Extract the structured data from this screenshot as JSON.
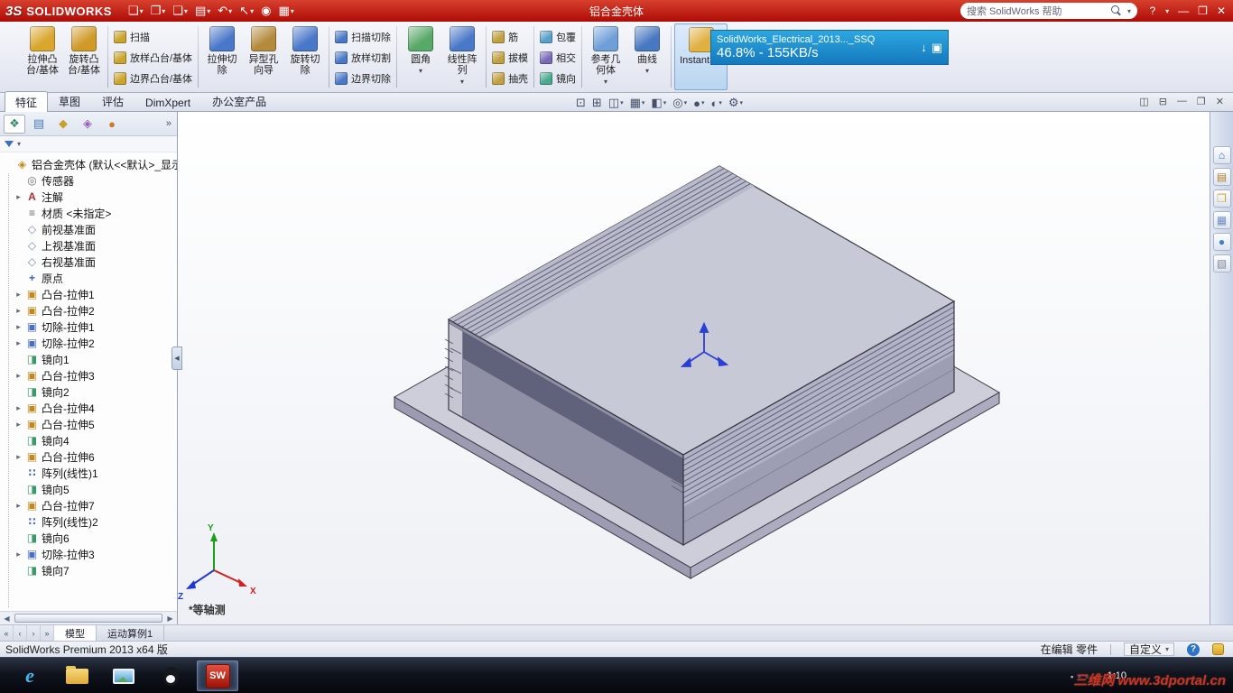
{
  "colors": {
    "title-red-1": "#d8402e",
    "title-red-2": "#ad0b05",
    "toast-blue-1": "#2da7e0",
    "toast-blue-2": "#1479bd",
    "model-top": "#c8c9d6",
    "model-top-band": "#b9bbcb",
    "model-front": "#8f90a6",
    "model-front-dark": "#60617a",
    "model-right": "#9d9eb3",
    "model-right-band": "#b2b3c6",
    "model-flange-top": "#cdceda",
    "model-flange-front": "#9b9cb2",
    "model-flange-side": "#abacbf",
    "model-cutface": "#c5c6d2",
    "model-edge": "#3a3a46",
    "model-stripe": "#5f607a",
    "axis-x": "#d42020",
    "axis-y": "#18a018",
    "axis-z": "#2038d0",
    "triad-blue": "#2a3fd4"
  },
  "glyphs": {
    "caret": "▾",
    "expand": "▸",
    "chevron": "»"
  },
  "titlebar": {
    "logo": "3S",
    "brand": "SOLIDWORKS",
    "document_title": "铝合金壳体",
    "search_placeholder": "搜索 SolidWorks 帮助",
    "controls": {
      "help": "?",
      "minimize": "—",
      "maximize": "❐",
      "close": "✕"
    },
    "quickbar": [
      {
        "name": "new",
        "glyph": "❏",
        "caret": true
      },
      {
        "name": "open",
        "glyph": "❐",
        "caret": true
      },
      {
        "name": "save",
        "glyph": "❑",
        "caret": true
      },
      {
        "name": "print",
        "glyph": "▤",
        "caret": true
      },
      {
        "name": "undo",
        "glyph": "↶",
        "caret": true
      },
      {
        "name": "select",
        "glyph": "↖",
        "caret": true
      },
      {
        "name": "rebuild",
        "glyph": "◉",
        "caret": false
      },
      {
        "name": "options",
        "glyph": "▦",
        "caret": true
      }
    ]
  },
  "ribbon": {
    "groups": [
      {
        "name": "boss-base-large",
        "type": "large",
        "buttons": [
          {
            "icon": "extruded-boss",
            "label": "拉伸凸\n台/基体",
            "caret": false
          },
          {
            "icon": "revolved-boss",
            "label": "旋转凸\n台/基体",
            "caret": false
          }
        ]
      },
      {
        "name": "boss-base-stack",
        "type": "stack",
        "buttons": [
          {
            "icon": "swept-boss",
            "label": "扫描",
            "caret": false
          },
          {
            "icon": "lofted-boss",
            "label": "放样凸台/基体",
            "caret": false
          },
          {
            "icon": "boundary-boss",
            "label": "边界凸台/基体",
            "caret": false
          }
        ]
      },
      {
        "name": "cut-large",
        "type": "large",
        "buttons": [
          {
            "icon": "extruded-cut",
            "label": "拉伸切\n除",
            "caret": false
          },
          {
            "icon": "hole-wizard",
            "label": "异型孔\n向导",
            "caret": false
          },
          {
            "icon": "revolved-cut",
            "label": "旋转切\n除",
            "caret": false
          }
        ]
      },
      {
        "name": "cut-stack",
        "type": "stack",
        "buttons": [
          {
            "icon": "swept-cut",
            "label": "扫描切除",
            "caret": false
          },
          {
            "icon": "lofted-cut",
            "label": "放样切割",
            "caret": false
          },
          {
            "icon": "boundary-cut",
            "label": "边界切除",
            "caret": false
          }
        ]
      },
      {
        "name": "pattern-large",
        "type": "large",
        "buttons": [
          {
            "icon": "fillet",
            "label": "圆角",
            "caret": true
          },
          {
            "icon": "linear-pattern",
            "label": "线性阵\n列",
            "caret": true
          }
        ]
      },
      {
        "name": "rib-stack",
        "type": "stack",
        "buttons": [
          {
            "icon": "rib",
            "label": "筋",
            "caret": false
          },
          {
            "icon": "draft",
            "label": "拔模",
            "caret": false
          },
          {
            "icon": "shell",
            "label": "抽壳",
            "caret": false
          }
        ]
      },
      {
        "name": "wrap-stack",
        "type": "stack",
        "buttons": [
          {
            "icon": "wrap",
            "label": "包覆",
            "caret": false
          },
          {
            "icon": "intersect",
            "label": "相交",
            "caret": false
          },
          {
            "icon": "mirror",
            "label": "镜向",
            "caret": false
          }
        ]
      },
      {
        "name": "reference-large",
        "type": "large",
        "buttons": [
          {
            "icon": "reference-geometry",
            "label": "参考几\n何体",
            "caret": true
          },
          {
            "icon": "curves",
            "label": "曲线",
            "caret": true
          }
        ]
      },
      {
        "name": "instant3d",
        "type": "large",
        "buttons": [
          {
            "icon": "instant3d",
            "label": "Instant3D",
            "caret": false,
            "active": true
          }
        ]
      }
    ]
  },
  "icon_colors": {
    "extruded-boss": "#d9a62e",
    "revolved-boss": "#cf9a28",
    "swept-boss": "#caa42c",
    "lofted-boss": "#caa42c",
    "boundary-boss": "#caa42c",
    "extruded-cut": "#4a78c8",
    "hole-wizard": "#b48a3c",
    "revolved-cut": "#4a78c8",
    "swept-cut": "#4a78c8",
    "lofted-cut": "#4a78c8",
    "boundary-cut": "#4a78c8",
    "fillet": "#58a868",
    "linear-pattern": "#4a78c8",
    "rib": "#c0a040",
    "draft": "#c0a040",
    "shell": "#c0a040",
    "wrap": "#58a0c8",
    "intersect": "#7a68b8",
    "mirror": "#48a890",
    "reference-geometry": "#6f9fd8",
    "curves": "#4878c0",
    "instant3d": "#e0b040"
  },
  "download_toast": {
    "line1": "SolidWorks_Electrical_2013..._SSQ",
    "line2": "46.8% - 155KB/s",
    "download_glyph": "↓",
    "monitor_glyph": "▣"
  },
  "command_tabs": {
    "active": 0,
    "items": [
      {
        "id": "features",
        "label": "特征"
      },
      {
        "id": "sketch",
        "label": "草图"
      },
      {
        "id": "evaluate",
        "label": "评估"
      },
      {
        "id": "dimxpert",
        "label": "DimXpert"
      },
      {
        "id": "office-products",
        "label": "办公室产品"
      }
    ]
  },
  "view_toolbar": [
    {
      "name": "zoom-fit",
      "glyph": "⊡",
      "caret": false
    },
    {
      "name": "zoom-area",
      "glyph": "⊞",
      "caret": false
    },
    {
      "name": "section-view",
      "glyph": "◫",
      "caret": true
    },
    {
      "name": "view-orientation",
      "glyph": "▦",
      "caret": true
    },
    {
      "name": "display-style",
      "glyph": "◧",
      "caret": true
    },
    {
      "name": "hide-show-items",
      "glyph": "◎",
      "caret": true
    },
    {
      "name": "edit-appearance",
      "glyph": "●",
      "caret": true
    },
    {
      "name": "apply-scene",
      "glyph": "◐",
      "caret": true
    },
    {
      "name": "view-settings",
      "glyph": "⚙",
      "caret": true
    }
  ],
  "doc_controls": [
    {
      "name": "doc-cascade",
      "glyph": "◫"
    },
    {
      "name": "doc-tile",
      "glyph": "⊟"
    },
    {
      "name": "doc-minimize",
      "glyph": "—"
    },
    {
      "name": "doc-restore",
      "glyph": "❐"
    },
    {
      "name": "doc-close",
      "glyph": "✕"
    }
  ],
  "feature_manager": {
    "tabs": [
      {
        "name": "featuremanager-design-tree",
        "glyph": "❖",
        "color": "#3a8a6a",
        "active": true
      },
      {
        "name": "propertymanager",
        "glyph": "▤",
        "color": "#4a7ac0",
        "active": false
      },
      {
        "name": "configurationmanager",
        "glyph": "◆",
        "color": "#c8a030",
        "active": false
      },
      {
        "name": "dimxpertmanager",
        "glyph": "◈",
        "color": "#9a60b8",
        "active": false
      },
      {
        "name": "displaymanager",
        "glyph": "●",
        "color": "#d07828",
        "active": false
      }
    ],
    "root": {
      "label": "铝合金壳体 (默认<<默认>_显示...",
      "icon": "part"
    },
    "items": [
      {
        "label": "传感器",
        "icon": "sensors",
        "expand": false
      },
      {
        "label": "注解",
        "icon": "annotations",
        "expand": true
      },
      {
        "label": "材质 <未指定>",
        "icon": "material",
        "expand": false
      },
      {
        "label": "前视基准面",
        "icon": "plane",
        "expand": false
      },
      {
        "label": "上视基准面",
        "icon": "plane",
        "expand": false
      },
      {
        "label": "右视基准面",
        "icon": "plane",
        "expand": false
      },
      {
        "label": "原点",
        "icon": "origin",
        "expand": false
      },
      {
        "label": "凸台-拉伸1",
        "icon": "boss-extrude",
        "expand": true
      },
      {
        "label": "凸台-拉伸2",
        "icon": "boss-extrude",
        "expand": true
      },
      {
        "label": "切除-拉伸1",
        "icon": "cut-extrude",
        "expand": true
      },
      {
        "label": "切除-拉伸2",
        "icon": "cut-extrude",
        "expand": true
      },
      {
        "label": "镜向1",
        "icon": "mirror",
        "expand": false
      },
      {
        "label": "凸台-拉伸3",
        "icon": "boss-extrude",
        "expand": true
      },
      {
        "label": "镜向2",
        "icon": "mirror",
        "expand": false
      },
      {
        "label": "凸台-拉伸4",
        "icon": "boss-extrude",
        "expand": true
      },
      {
        "label": "凸台-拉伸5",
        "icon": "boss-extrude",
        "expand": true
      },
      {
        "label": "镜向4",
        "icon": "mirror",
        "expand": false
      },
      {
        "label": "凸台-拉伸6",
        "icon": "boss-extrude",
        "expand": true
      },
      {
        "label": "阵列(线性)1",
        "icon": "linear-pattern",
        "expand": false
      },
      {
        "label": "镜向5",
        "icon": "mirror",
        "expand": false
      },
      {
        "label": "凸台-拉伸7",
        "icon": "boss-extrude",
        "expand": true
      },
      {
        "label": "阵列(线性)2",
        "icon": "linear-pattern",
        "expand": false
      },
      {
        "label": "镜向6",
        "icon": "mirror",
        "expand": false
      },
      {
        "label": "切除-拉伸3",
        "icon": "cut-extrude",
        "expand": true
      },
      {
        "label": "镜向7",
        "icon": "mirror",
        "expand": false
      }
    ]
  },
  "tree_icons": {
    "part": {
      "glyph": "◈",
      "color": "#c08a20"
    },
    "sensors": {
      "glyph": "◎",
      "color": "#707070"
    },
    "annotations": {
      "glyph": "A",
      "color": "#b03030"
    },
    "material": {
      "glyph": "≡",
      "color": "#6a6a6a"
    },
    "plane": {
      "glyph": "◇",
      "color": "#7c8aa6"
    },
    "origin": {
      "glyph": "+",
      "color": "#3a5fbf"
    },
    "boss-extrude": {
      "glyph": "▣",
      "color": "#c08a20"
    },
    "cut-extrude": {
      "glyph": "▣",
      "color": "#4a6fc0"
    },
    "mirror": {
      "glyph": "◨",
      "color": "#3a9a6a"
    },
    "linear-pattern": {
      "glyph": "∷",
      "color": "#4a6fc0"
    }
  },
  "viewport": {
    "view_label": "*等轴测",
    "triad": {
      "x": "X",
      "y": "Y",
      "z": "Z"
    }
  },
  "task_pane": [
    {
      "name": "solidworks-resources",
      "glyph": "⌂",
      "color": "#2e6fb0"
    },
    {
      "name": "design-library",
      "glyph": "▤",
      "color": "#b08030"
    },
    {
      "name": "file-explorer",
      "glyph": "❒",
      "color": "#caa43a"
    },
    {
      "name": "view-palette",
      "glyph": "▦",
      "color": "#6f8fc0"
    },
    {
      "name": "appearances-scenes",
      "glyph": "●",
      "color": "#3a7fd0"
    },
    {
      "name": "custom-properties",
      "glyph": "▧",
      "color": "#808898"
    }
  ],
  "bottom_bar": {
    "nav": [
      "«",
      "‹",
      "›",
      "»"
    ],
    "tabs": [
      {
        "id": "model",
        "label": "模型",
        "active": true
      },
      {
        "id": "motion-study-1",
        "label": "运动算例1",
        "active": false
      }
    ]
  },
  "statusbar": {
    "left": "SolidWorks Premium 2013 x64 版",
    "editing": "在编辑 零件",
    "custom": "自定义",
    "help_glyph": "?"
  },
  "taskbar": {
    "items": [
      {
        "name": "internet-explorer",
        "glyph": "e",
        "active": false
      },
      {
        "name": "file-explorer",
        "glyph": "",
        "active": false
      },
      {
        "name": "photo-viewer",
        "glyph": "",
        "active": false
      },
      {
        "name": "qq",
        "glyph": "",
        "active": false
      },
      {
        "name": "solidworks",
        "glyph": "SW",
        "active": true
      }
    ],
    "tray_icons": [
      "▪",
      "◦",
      "▫"
    ],
    "clock": "1:10",
    "watermark": "三维网 www.3dportal.cn"
  }
}
